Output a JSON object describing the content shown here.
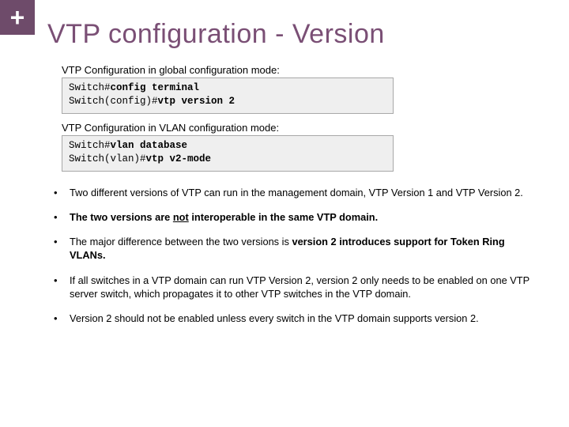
{
  "corner": {
    "symbol": "+"
  },
  "title": "VTP configuration - Version",
  "section1": {
    "label": "VTP Configuration in global configuration mode:",
    "line1_prompt": "Switch#",
    "line1_cmd": "config terminal",
    "line2_prompt": "Switch(config)#",
    "line2_cmd": "vtp version 2"
  },
  "section2": {
    "label": "VTP Configuration in VLAN configuration mode:",
    "line1_prompt": "Switch#",
    "line1_cmd": "vlan database",
    "line2_prompt": "Switch(vlan)#",
    "line2_cmd": "vtp v2-mode"
  },
  "bullets": {
    "b1": "Two different versions of VTP can run in the management domain, VTP Version 1 and VTP Version 2.",
    "b2_a": "The two versions are ",
    "b2_not": "not",
    "b2_b": " interoperable in the same VTP domain.",
    "b3_a": "The major difference between the two versions is ",
    "b3_b": "version 2 introduces support for Token Ring VLANs.",
    "b4": "If all switches in a VTP domain can run VTP Version 2, version 2 only needs to be enabled on one VTP server switch, which propagates it to other VTP switches in the VTP domain.",
    "b5": "Version 2 should not be enabled unless every switch in the VTP domain supports version 2."
  }
}
